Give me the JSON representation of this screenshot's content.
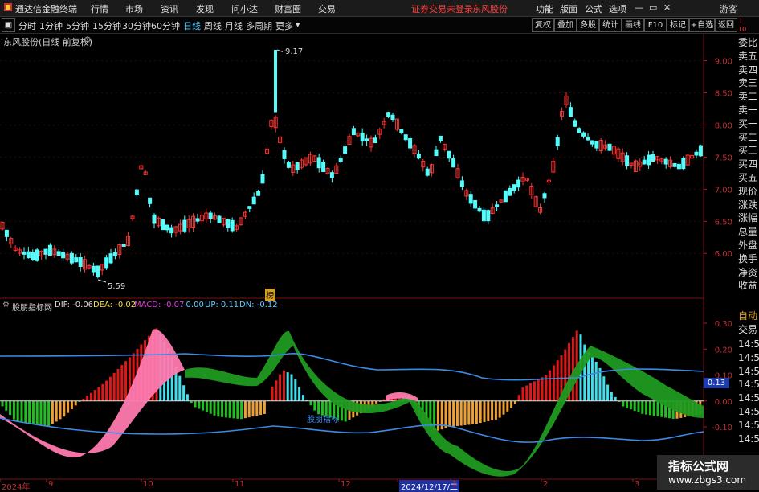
{
  "titlebar": {
    "app_name": "通达信金融终端",
    "menus": [
      "行情",
      "市场",
      "资讯",
      "发现",
      "问小达",
      "财富圈",
      "交易"
    ],
    "login_status": "证券交易未登录",
    "stock_name": "东风股份",
    "right_menus": [
      "功能",
      "版面",
      "公式",
      "选项"
    ],
    "guest": "游客"
  },
  "toolbar": {
    "periods": [
      "分时",
      "1分钟",
      "5分钟",
      "15分钟",
      "30分钟",
      "60分钟",
      "日线",
      "周线",
      "月线",
      "多周期",
      "更多"
    ],
    "active_period": "日线",
    "right_buttons": [
      "复权",
      "叠加",
      "多股",
      "统计",
      "画线",
      "F10",
      "标记",
      "+自选",
      "返回"
    ],
    "badge_top": "I",
    "badge_bottom": "10"
  },
  "main_chart": {
    "title": "东风股份(日线 前复权)",
    "high_label": "9.17",
    "low_label": "5.59",
    "marker_label": "榜",
    "y_ticks": [
      "9.00",
      "8.50",
      "8.00",
      "7.50",
      "7.00",
      "6.50",
      "6.00"
    ]
  },
  "indicator": {
    "name": "股朋指标网",
    "dif": "DIF: -0.06",
    "dea": "DEA: -0.02",
    "macd": "MACD: -0.07",
    "zero": ": 0.00",
    "up": "UP: 0.11",
    "dn": "DN: -0.12",
    "y_ticks": [
      "0.30",
      "0.20",
      "0.10",
      "0.00",
      "-0.10"
    ],
    "current_value": "0.13",
    "label_bottom": "股朋指标"
  },
  "right_panel": {
    "items": [
      "委比",
      "卖五",
      "卖四",
      "卖三",
      "卖二",
      "卖一",
      "买一",
      "买二",
      "买三",
      "买四",
      "买五",
      "现价",
      "涨跌",
      "涨幅",
      "总量",
      "外盘",
      "换手",
      "净资",
      "收益"
    ],
    "auto": "自动",
    "trade": "交易",
    "times": [
      "14:56",
      "14:56",
      "14:56",
      "14:56",
      "14:56",
      "14:56",
      "14:56",
      "14:56"
    ]
  },
  "x_axis": {
    "labels": [
      "2024年",
      "9",
      "10",
      "11",
      "12",
      "2024/12/17/二",
      "1",
      "2",
      "3"
    ]
  },
  "watermark": {
    "line1": "指标公式网",
    "line2": "www.zbgs3.com"
  },
  "colors": {
    "up": "#ff3333",
    "down": "#54fcfc",
    "macd_pos": "#e01818",
    "macd_pos_fade": "#40e0f0",
    "macd_neg": "#f0a030",
    "macd_neg_green": "#20c020",
    "band_pink": "#ff7ab0",
    "band_green": "#209a20",
    "line_blue": "#3a8ae6"
  }
}
